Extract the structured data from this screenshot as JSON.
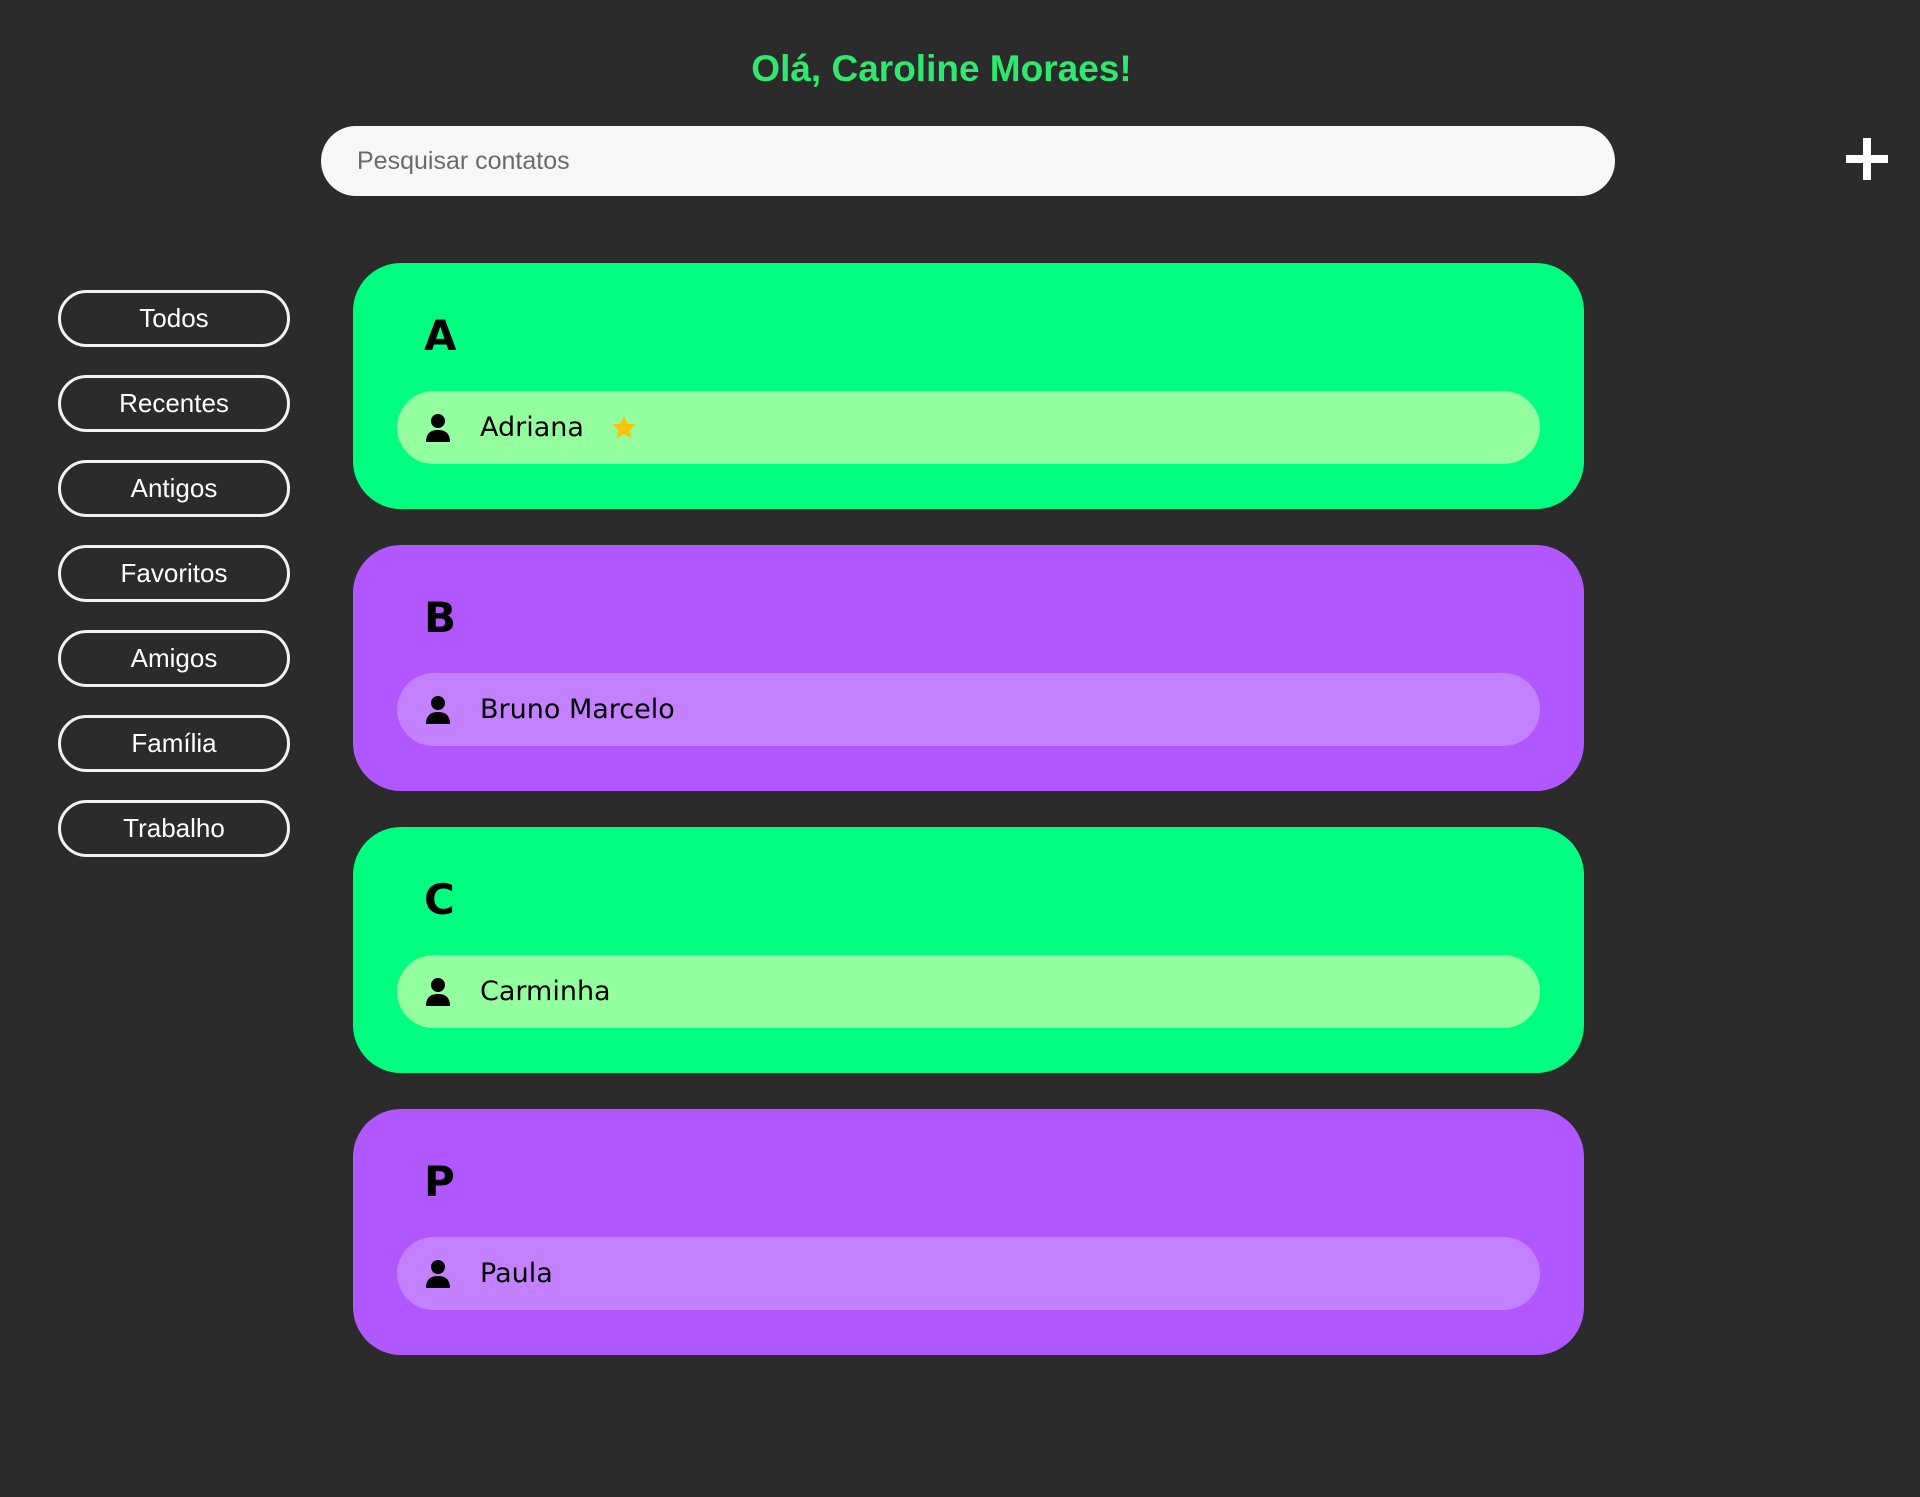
{
  "header": {
    "greeting": "Olá, Caroline Moraes!"
  },
  "search": {
    "placeholder": "Pesquisar contatos",
    "value": ""
  },
  "add_button": {
    "icon": "plus-icon"
  },
  "filters": [
    {
      "label": "Todos"
    },
    {
      "label": "Recentes"
    },
    {
      "label": "Antigos"
    },
    {
      "label": "Favoritos"
    },
    {
      "label": "Amigos"
    },
    {
      "label": "Família"
    },
    {
      "label": "Trabalho"
    }
  ],
  "colors": {
    "background": "#2b2b2b",
    "accent_green": "#00ff80",
    "accent_purple": "#b057ff",
    "contact_green": "#94ff9e",
    "contact_purple": "#c380ff",
    "greeting": "#2ee86f",
    "star": "#ffc107"
  },
  "groups": [
    {
      "letter": "A",
      "color": "green",
      "contacts": [
        {
          "name": "Adriana",
          "favorite": true
        }
      ]
    },
    {
      "letter": "B",
      "color": "purple",
      "contacts": [
        {
          "name": "Bruno Marcelo",
          "favorite": false
        }
      ]
    },
    {
      "letter": "C",
      "color": "green",
      "contacts": [
        {
          "name": "Carminha",
          "favorite": false
        }
      ]
    },
    {
      "letter": "P",
      "color": "purple",
      "contacts": [
        {
          "name": "Paula",
          "favorite": false
        }
      ]
    }
  ]
}
